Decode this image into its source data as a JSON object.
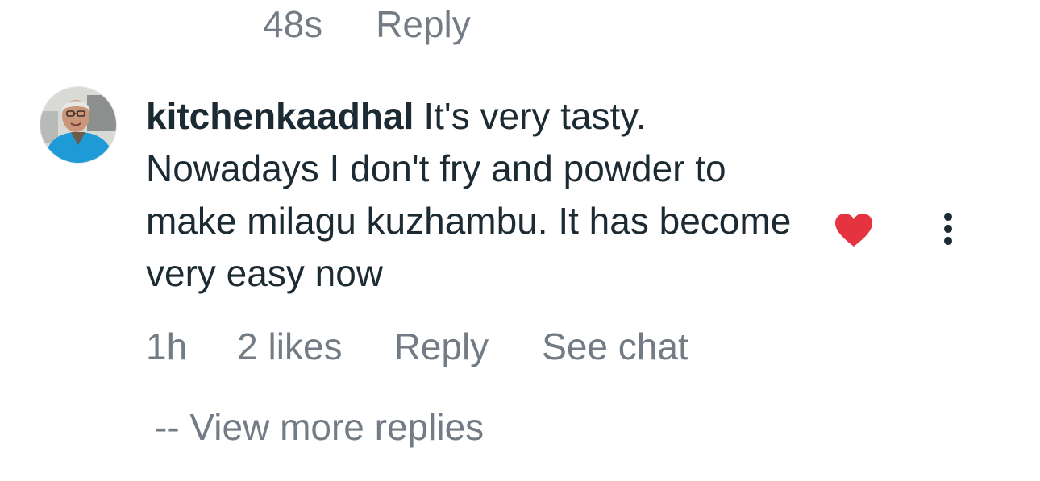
{
  "previous_comment": {
    "time": "48s",
    "reply_label": "Reply"
  },
  "comment": {
    "username": "kitchenkaadhal",
    "text": "It's very tasty. Nowadays I don't fry and powder to make milagu kuzhambu. It has become very easy now",
    "time": "1h",
    "likes": "2 likes",
    "reply_label": "Reply",
    "see_chat_label": "See chat",
    "liked": true
  },
  "view_more_replies": "-- View more replies",
  "colors": {
    "text_primary": "#1c2b33",
    "text_secondary": "#737b85",
    "heart": "#e5343f",
    "background": "#ffffff"
  },
  "icons": {
    "like": "heart-icon",
    "options": "more-vertical-icon"
  }
}
